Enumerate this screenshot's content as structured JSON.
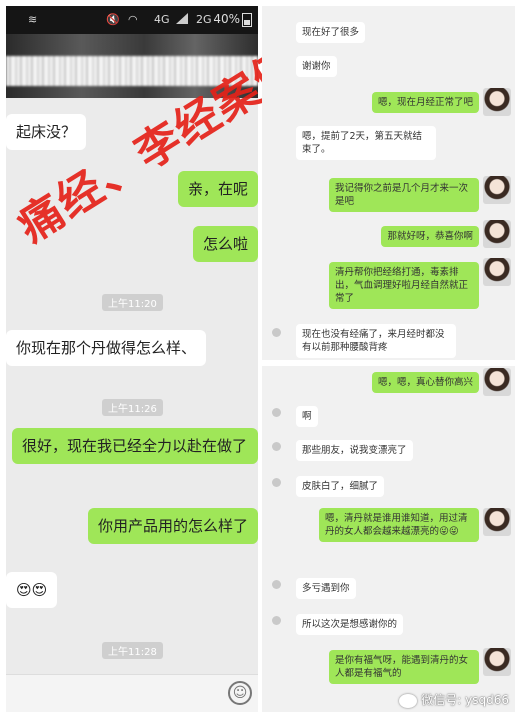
{
  "status_bar": {
    "network_left": "4G",
    "network_right": "2G",
    "battery": "40%"
  },
  "left_chat": {
    "messages": [
      {
        "side": "recv",
        "text": "起床没？"
      },
      {
        "side": "sent",
        "text": "亲，在呢"
      },
      {
        "side": "sent",
        "text": "怎么啦"
      },
      {
        "side": "recv",
        "text": "你现在那个丹做得怎么样、"
      },
      {
        "side": "sent",
        "text": "很好，现在我已经全力以赴在做了"
      },
      {
        "side": "sent",
        "text": "你用产品用的怎么样了"
      },
      {
        "side": "recv",
        "text": "😍😍"
      }
    ],
    "times": [
      "上午11:20",
      "上午11:26",
      "上午11:28"
    ]
  },
  "stamp": "痛经、李经案例",
  "right_chat_1": {
    "messages": [
      {
        "side": "recv",
        "text": "现在好了很多"
      },
      {
        "side": "recv",
        "text": "谢谢你"
      },
      {
        "side": "sent",
        "text": "嗯，现在月经正常了吧"
      },
      {
        "side": "recv",
        "text": "嗯，提前了2天，第五天就结束了。"
      },
      {
        "side": "sent",
        "text": "我记得你之前是几个月才来一次是吧"
      },
      {
        "side": "sent",
        "text": "那就好呀，恭喜你啊"
      },
      {
        "side": "sent",
        "text": "清丹帮你把经络打通，毒素排出，气血调理好啦月经自然就正常了"
      },
      {
        "side": "recv",
        "text": "现在也没有经痛了，来月经时都没有以前那种腰酸背疼"
      }
    ]
  },
  "right_chat_2": {
    "messages": [
      {
        "side": "sent",
        "text": "嗯，嗯，真心替你高兴"
      },
      {
        "side": "recv",
        "text": "啊"
      },
      {
        "side": "recv",
        "text": "那些朋友，说我变漂亮了"
      },
      {
        "side": "recv",
        "text": "皮肤白了，细腻了"
      },
      {
        "side": "sent",
        "text": "嗯，清丹就是谁用谁知道，用过清丹的女人都会越来越漂亮的😜😜"
      },
      {
        "side": "recv",
        "text": "多亏遇到你"
      },
      {
        "side": "recv",
        "text": "所以这次是想感谢你的"
      },
      {
        "side": "sent",
        "text": "是你有福气呀，能遇到清丹的女人都是有福气的"
      }
    ]
  },
  "watermark": "微信号: ysqd66"
}
